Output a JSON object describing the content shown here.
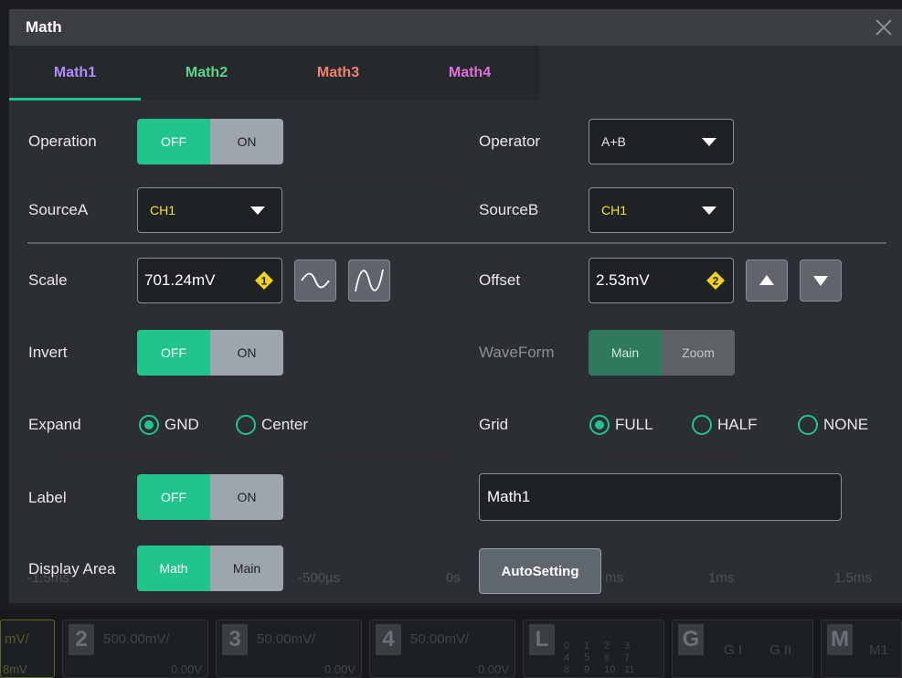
{
  "window": {
    "title": "Math"
  },
  "tabs": [
    {
      "label": "Math1",
      "color": "#b48cff",
      "active": true
    },
    {
      "label": "Math2",
      "color": "#58d68d",
      "active": false
    },
    {
      "label": "Math3",
      "color": "#f08070",
      "active": false
    },
    {
      "label": "Math4",
      "color": "#e070e0",
      "active": false
    }
  ],
  "operation": {
    "label": "Operation",
    "off": "OFF",
    "on": "ON",
    "selected": "OFF"
  },
  "operator": {
    "label": "Operator",
    "value": "A+B"
  },
  "sourceA": {
    "label": "SourceA",
    "value": "CH1",
    "value_color": "#f2e31b"
  },
  "sourceB": {
    "label": "SourceB",
    "value": "CH1",
    "value_color": "#f2e31b"
  },
  "scale": {
    "label": "Scale",
    "value": "701.24mV",
    "knob": "1"
  },
  "offset": {
    "label": "Offset",
    "value": "2.53mV",
    "knob": "2"
  },
  "invert": {
    "label": "Invert",
    "off": "OFF",
    "on": "ON",
    "selected": "OFF"
  },
  "waveform": {
    "label": "WaveForm",
    "main": "Main",
    "zoom": "Zoom",
    "selected": "Main"
  },
  "expand": {
    "label": "Expand",
    "options": [
      "GND",
      "Center"
    ],
    "selected": "GND"
  },
  "grid": {
    "label": "Grid",
    "options": [
      "FULL",
      "HALF",
      "NONE"
    ],
    "selected": "FULL"
  },
  "label": {
    "label": "Label",
    "off": "OFF",
    "on": "ON",
    "selected": "OFF",
    "text": "Math1"
  },
  "display_area": {
    "label": "Display Area",
    "math": "Math",
    "main": "Main",
    "selected": "Math"
  },
  "autosetting": {
    "label": "AutoSetting"
  },
  "background": {
    "time_axis": [
      "-1.5ms",
      "-500µs",
      "0s",
      "ms",
      "1ms",
      "1.5ms"
    ]
  },
  "bottombar": {
    "ch1": {
      "text": "mV/",
      "sub": "8mV"
    },
    "ch2": {
      "num": "2",
      "text": "500.00mV/",
      "sub": "0.00V"
    },
    "ch3": {
      "num": "3",
      "text": "50.00mV/",
      "sub": "0.00V"
    },
    "ch4": {
      "num": "4",
      "text": "50.00mV/",
      "sub": "0.00V"
    },
    "logic": {
      "num": "L",
      "digits": [
        "0",
        "1",
        "2",
        "3",
        "4",
        "5",
        "6",
        "7",
        "8",
        "9",
        "10",
        "11"
      ]
    },
    "gen": {
      "num": "G",
      "g1": "G I",
      "g2": "G II"
    },
    "math": {
      "num": "M",
      "m1": "M1"
    }
  }
}
